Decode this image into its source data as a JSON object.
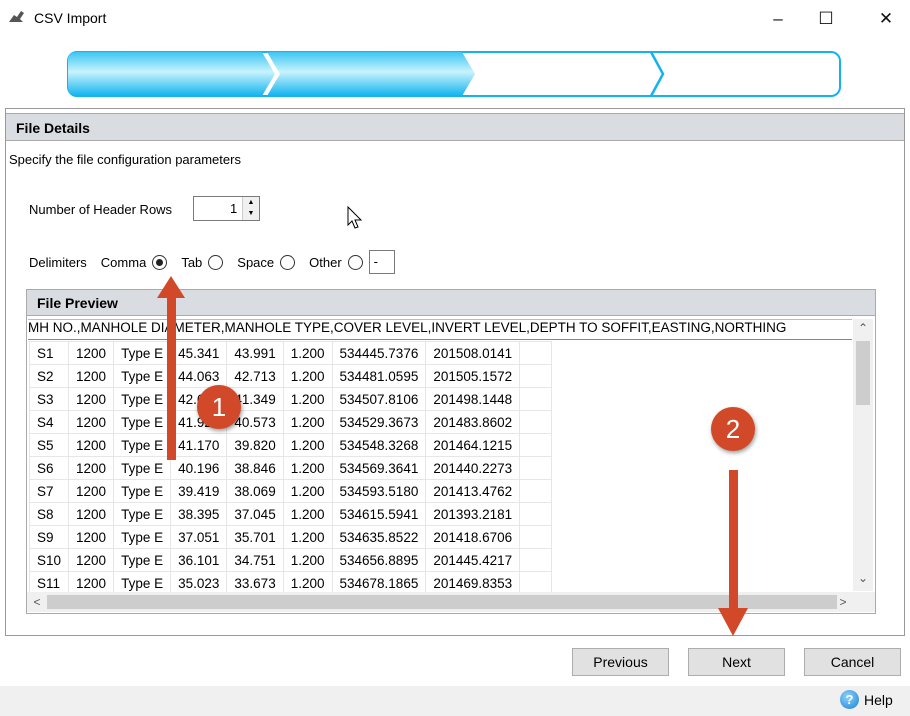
{
  "window": {
    "title": "CSV Import",
    "minimize": "–",
    "maximize": "☐",
    "close": "✕"
  },
  "progress": {
    "total_steps": 4,
    "completed_steps": 2,
    "accent": "#12b3ee"
  },
  "file_details": {
    "header": "File Details",
    "description": "Specify the file configuration parameters",
    "header_rows_label": "Number of Header Rows",
    "header_rows_value": "1",
    "delimiters_label": "Delimiters",
    "delimiters": [
      {
        "label": "Comma",
        "selected": true
      },
      {
        "label": "Tab",
        "selected": false
      },
      {
        "label": "Space",
        "selected": false
      },
      {
        "label": "Other",
        "selected": false
      }
    ],
    "other_value": "-"
  },
  "preview": {
    "header": "File Preview",
    "raw_header": "MH NO.,MANHOLE DIAMETER,MANHOLE TYPE,COVER LEVEL,INVERT LEVEL,DEPTH TO SOFFIT,EASTING,NORTHING",
    "rows": [
      [
        "S1",
        "1200",
        "Type E",
        "45.341",
        "43.991",
        "1.200",
        "534445.7376",
        "201508.0141"
      ],
      [
        "S2",
        "1200",
        "Type E",
        "44.063",
        "42.713",
        "1.200",
        "534481.0595",
        "201505.1572"
      ],
      [
        "S3",
        "1200",
        "Type E",
        "42.699",
        "41.349",
        "1.200",
        "534507.8106",
        "201498.1448"
      ],
      [
        "S4",
        "1200",
        "Type E",
        "41.923",
        "40.573",
        "1.200",
        "534529.3673",
        "201483.8602"
      ],
      [
        "S5",
        "1200",
        "Type E",
        "41.170",
        "39.820",
        "1.200",
        "534548.3268",
        "201464.1215"
      ],
      [
        "S6",
        "1200",
        "Type E",
        "40.196",
        "38.846",
        "1.200",
        "534569.3641",
        "201440.2273"
      ],
      [
        "S7",
        "1200",
        "Type E",
        "39.419",
        "38.069",
        "1.200",
        "534593.5180",
        "201413.4762"
      ],
      [
        "S8",
        "1200",
        "Type E",
        "38.395",
        "37.045",
        "1.200",
        "534615.5941",
        "201393.2181"
      ],
      [
        "S9",
        "1200",
        "Type E",
        "37.051",
        "35.701",
        "1.200",
        "534635.8522",
        "201418.6706"
      ],
      [
        "S10",
        "1200",
        "Type E",
        "36.101",
        "34.751",
        "1.200",
        "534656.8895",
        "201445.4217"
      ],
      [
        "S11",
        "1200",
        "Type E",
        "35.023",
        "33.673",
        "1.200",
        "534678.1865",
        "201469.8353"
      ]
    ]
  },
  "buttons": {
    "previous": "Previous",
    "next": "Next",
    "cancel": "Cancel",
    "help": "Help"
  },
  "annotations": [
    {
      "label": "1",
      "color": "#d2492a"
    },
    {
      "label": "2",
      "color": "#d2492a"
    }
  ]
}
